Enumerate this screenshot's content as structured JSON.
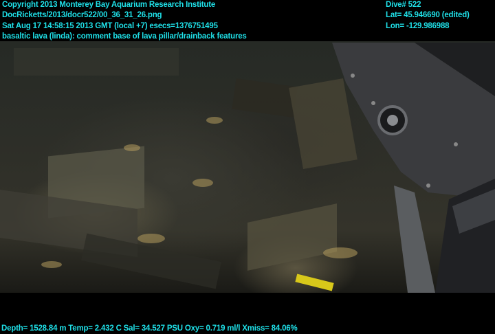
{
  "overlay": {
    "copyright": "Copyright 2013 Monterey Bay Aquarium Research Institute",
    "file": "DocRicketts/2013/docr522/00_36_31_26.png",
    "timestamp": "Sat Aug 17 14:58:15 2013 GMT (local +7)  esecs=1376751495",
    "comment": "basaltic lava (linda): comment base of lava pillar/drainback features",
    "dive": "Dive# 522",
    "lat": "Lat= 45.946690 (edited)",
    "lon": "Lon= -129.986988",
    "sensors": "Depth= 1528.84 m  Temp= 2.432 C  Sal= 34.527 PSU  Oxy= 0.719 ml/l  Xmiss= 84.06%"
  },
  "colors": {
    "overlay_text": "#1fe0e8"
  }
}
